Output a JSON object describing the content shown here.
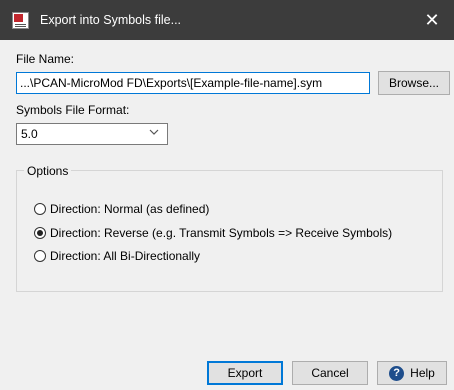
{
  "window": {
    "title": "Export into Symbols file...",
    "close_glyph": "✕"
  },
  "file_name": {
    "label": "File Name:",
    "value": "...\\PCAN-MicroMod FD\\Exports\\[Example-file-name].sym",
    "browse_label": "Browse..."
  },
  "format": {
    "label": "Symbols File Format:",
    "selected": "5.0"
  },
  "options": {
    "legend": "Options",
    "items": [
      {
        "label": "Direction: Normal (as defined)",
        "checked": false
      },
      {
        "label": "Direction: Reverse (e.g. Transmit Symbols => Receive Symbols)",
        "checked": true
      },
      {
        "label": "Direction: All Bi-Directionally",
        "checked": false
      }
    ]
  },
  "buttons": {
    "export": "Export",
    "cancel": "Cancel",
    "help": "Help",
    "help_icon": "question-circle"
  }
}
